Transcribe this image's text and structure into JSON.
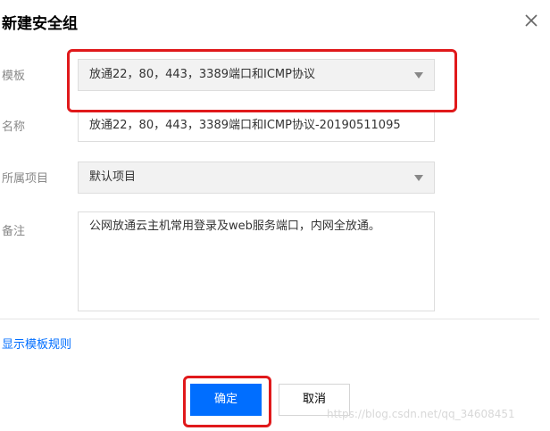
{
  "dialog": {
    "title": "新建安全组",
    "close_icon": "close-icon"
  },
  "form": {
    "template": {
      "label": "模板",
      "value": "放通22，80，443，3389端口和ICMP协议"
    },
    "name": {
      "label": "名称",
      "value": "放通22，80，443，3389端口和ICMP协议-20190511095"
    },
    "project": {
      "label": "所属项目",
      "value": "默认项目"
    },
    "remark": {
      "label": "备注",
      "value": "公网放通云主机常用登录及web服务端口，内网全放通。"
    }
  },
  "links": {
    "show_rules": "显示模板规则"
  },
  "buttons": {
    "confirm": "确定",
    "cancel": "取消"
  },
  "watermark": "https://blog.csdn.net/qq_34608451",
  "colors": {
    "accent": "#006eff",
    "annotation": "#e0191b"
  }
}
